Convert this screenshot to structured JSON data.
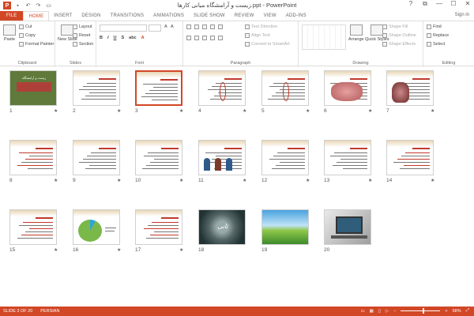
{
  "window": {
    "title": "زیست و آرامشگاه میانی کارها.ppt - PowerPoint",
    "controls": [
      "?",
      "⧉",
      "—",
      "☐",
      "✕"
    ],
    "signin": "Sign in"
  },
  "ribbon_tabs": [
    "FILE",
    "HOME",
    "INSERT",
    "DESIGN",
    "TRANSITIONS",
    "ANIMATIONS",
    "SLIDE SHOW",
    "REVIEW",
    "VIEW",
    "ADD-INS"
  ],
  "ribbon": {
    "clipboard": {
      "label": "Clipboard",
      "paste": "Paste",
      "cut": "Cut",
      "copy": "Copy",
      "format_painter": "Format Painter"
    },
    "slides": {
      "label": "Slides",
      "new_slide": "New Slide",
      "layout": "Layout",
      "reset": "Reset",
      "section": "Section"
    },
    "font": {
      "label": "Font"
    },
    "paragraph": {
      "label": "Paragraph",
      "text_direction": "Text Direction",
      "align_text": "Align Text",
      "convert": "Convert to SmartArt"
    },
    "drawing": {
      "label": "Drawing",
      "arrange": "Arrange",
      "quick_styles": "Quick Styles",
      "shape_fill": "Shape Fill",
      "shape_outline": "Shape Outline",
      "shape_effects": "Shape Effects"
    },
    "editing": {
      "label": "Editing",
      "find": "Find",
      "replace": "Replace",
      "select": "Select"
    }
  },
  "slides": [
    {
      "n": "1",
      "kind": "title"
    },
    {
      "n": "2",
      "kind": "text"
    },
    {
      "n": "3",
      "kind": "text",
      "selected": true
    },
    {
      "n": "4",
      "kind": "diagram"
    },
    {
      "n": "5",
      "kind": "diagram"
    },
    {
      "n": "6",
      "kind": "image-heart"
    },
    {
      "n": "7",
      "kind": "image-organ"
    },
    {
      "n": "8",
      "kind": "text-red"
    },
    {
      "n": "9",
      "kind": "text"
    },
    {
      "n": "10",
      "kind": "text"
    },
    {
      "n": "11",
      "kind": "image-people"
    },
    {
      "n": "12",
      "kind": "text"
    },
    {
      "n": "13",
      "kind": "text"
    },
    {
      "n": "14",
      "kind": "text-red"
    },
    {
      "n": "15",
      "kind": "text-red"
    },
    {
      "n": "16",
      "kind": "pie"
    },
    {
      "n": "17",
      "kind": "text-red"
    },
    {
      "n": "18",
      "kind": "photo-dark"
    },
    {
      "n": "19",
      "kind": "photo-landscape"
    },
    {
      "n": "20",
      "kind": "photo-laptop"
    }
  ],
  "slide1_title": "زیست و آرامشگاه",
  "slide18_text": "ثانی",
  "status": {
    "slide": "SLIDE 3 OF 20",
    "language": "PERSIAN",
    "zoom": "68%"
  }
}
